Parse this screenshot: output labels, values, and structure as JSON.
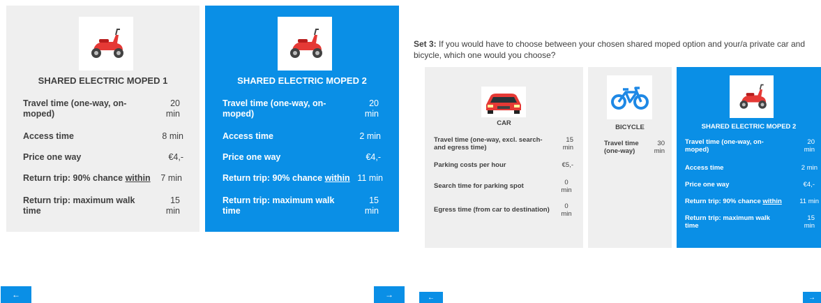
{
  "left": {
    "option1": {
      "title": "SHARED ELECTRIC MOPED 1",
      "travel_label": "Travel time (one-way, on-moped)",
      "travel_value": "20 min",
      "access_label": "Access time",
      "access_value": "8 min",
      "price_label": "Price one way",
      "price_value": "€4,-",
      "return_prefix": "Return trip: 90% chance ",
      "return_within": "within",
      "return_value": "7 min",
      "walk_label": "Return trip: maximum walk time",
      "walk_value": "15 min"
    },
    "option2": {
      "title": "SHARED ELECTRIC MOPED 2",
      "travel_label": "Travel time (one-way, on-moped)",
      "travel_value": "20 min",
      "access_label": "Access time",
      "access_value": "2 min",
      "price_label": "Price one way",
      "price_value": "€4,-",
      "return_prefix": "Return trip: 90% chance ",
      "return_within": "within",
      "return_value": "11 min",
      "walk_label": "Return trip: maximum walk time",
      "walk_value": "15 min"
    },
    "prev_arrow": "←",
    "next_arrow": "→"
  },
  "right": {
    "question_set": "Set 3:",
    "question_text": " If you would have to choose between your chosen shared moped option and your/a private car and bicycle, which one would you choose?",
    "car": {
      "title": "CAR",
      "travel_label": "Travel time (one-way, excl. search-and egress time)",
      "travel_value": "15 min",
      "parking_label": "Parking costs per hour",
      "parking_value": "€5,-",
      "search_label": "Search time for parking spot",
      "search_value": "0 min",
      "egress_label": "Egress time (from car to destination)",
      "egress_value": "0 min"
    },
    "bicycle": {
      "title": "BICYCLE",
      "travel_label": "Travel time (one-way)",
      "travel_value": "30 min"
    },
    "moped": {
      "title": "SHARED ELECTRIC MOPED 2",
      "travel_label": "Travel time (one-way, on-moped)",
      "travel_value": "20 min",
      "access_label": "Access time",
      "access_value": "2 min",
      "price_label": "Price one way",
      "price_value": "€4,-",
      "return_prefix": "Return trip: 90% chance ",
      "return_within": "within",
      "return_value": "11 min",
      "walk_label": "Return trip: maximum walk time",
      "walk_value": "15 min"
    },
    "prev_arrow": "←",
    "next_arrow": "→"
  },
  "icons": {
    "moped": "scooter-icon",
    "car": "car-icon",
    "bicycle": "bicycle-icon"
  },
  "colors": {
    "selected_blue": "#0a8fe6",
    "card_grey": "#efefef",
    "moped_red": "#e53935",
    "car_red": "#e53935",
    "bicycle_blue": "#1e88e5"
  }
}
